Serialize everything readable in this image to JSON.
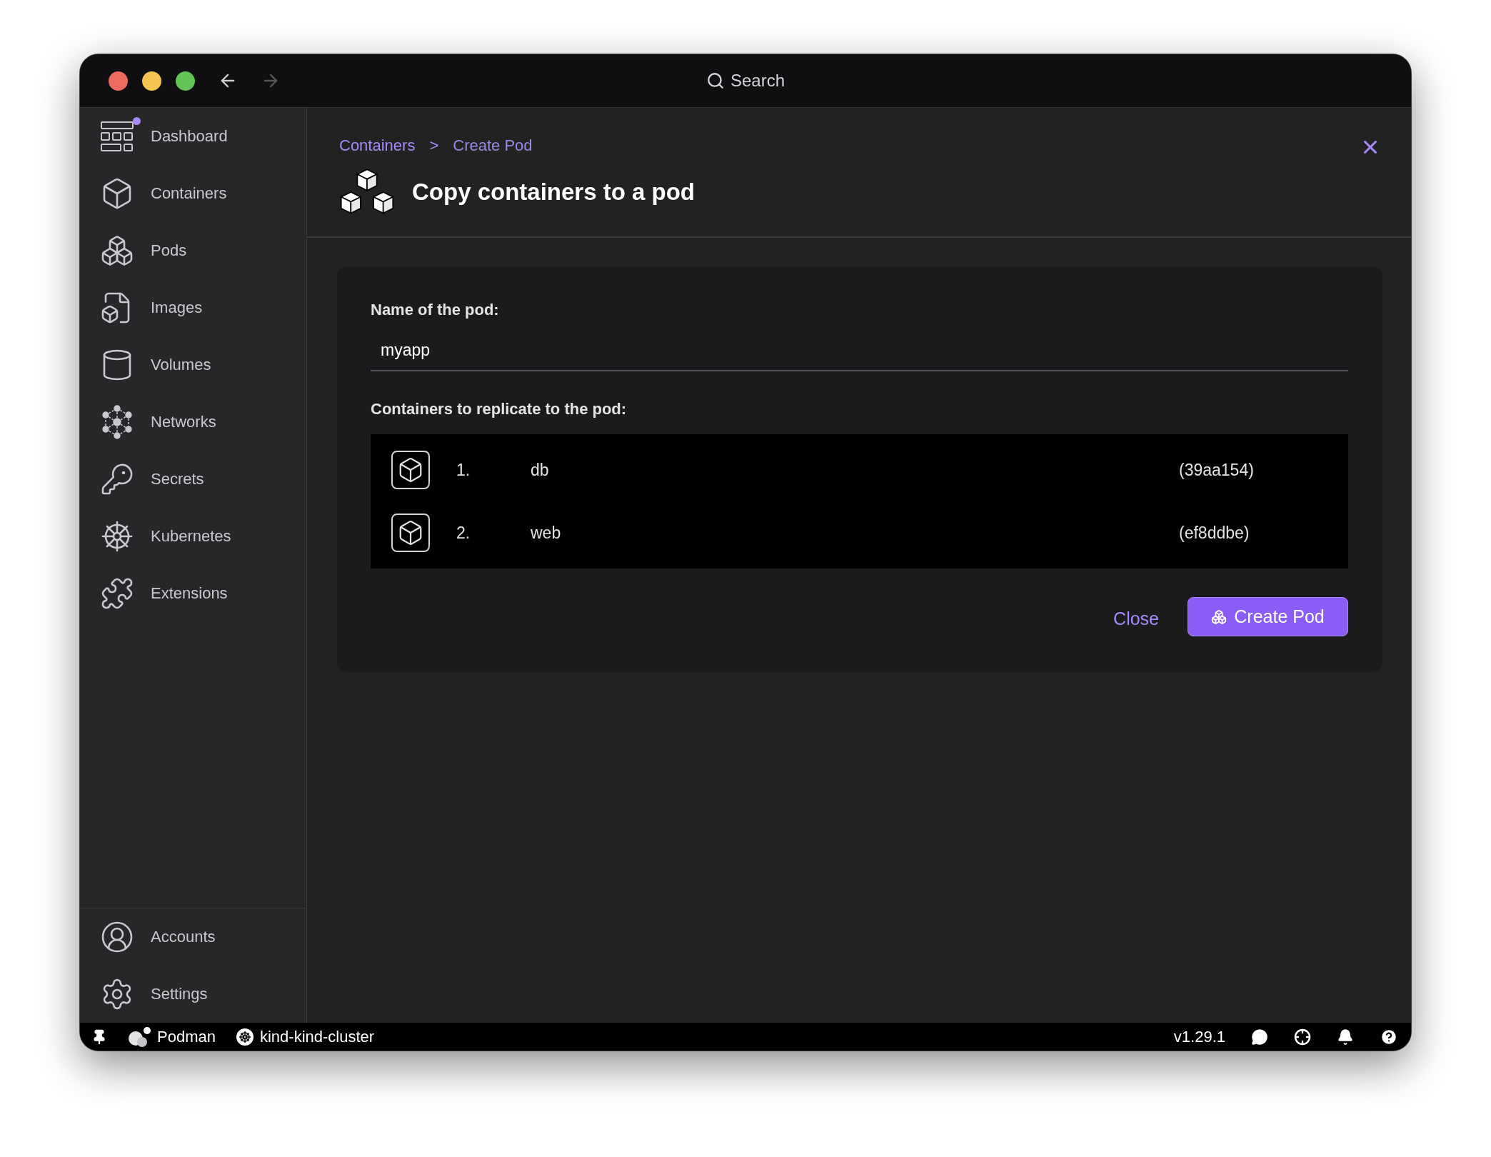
{
  "titlebar": {
    "search": "Search"
  },
  "sidebar": {
    "items": [
      {
        "label": "Dashboard",
        "notification": true
      },
      {
        "label": "Containers",
        "notification": false
      },
      {
        "label": "Pods",
        "notification": false
      },
      {
        "label": "Images",
        "notification": false
      },
      {
        "label": "Volumes",
        "notification": false
      },
      {
        "label": "Networks",
        "notification": false
      },
      {
        "label": "Secrets",
        "notification": false
      },
      {
        "label": "Kubernetes",
        "notification": false
      },
      {
        "label": "Extensions",
        "notification": false
      }
    ],
    "bottom_items": [
      {
        "label": "Accounts"
      },
      {
        "label": "Settings"
      }
    ]
  },
  "breadcrumb": {
    "parent": "Containers",
    "separator": ">",
    "current": "Create Pod"
  },
  "title": "Copy containers to a pod",
  "form": {
    "name_label": "Name of the pod:",
    "name_value": "myapp",
    "containers_label": "Containers to replicate to the pod:",
    "containers": [
      {
        "number": "1.",
        "name": "db",
        "id": "(39aa154)"
      },
      {
        "number": "2.",
        "name": "web",
        "id": "(ef8ddbe)"
      }
    ]
  },
  "buttons": {
    "close": "Close",
    "create": "Create Pod"
  },
  "status_bar": {
    "engine": "Podman",
    "cluster": "kind-kind-cluster",
    "version": "v1.29.1"
  }
}
